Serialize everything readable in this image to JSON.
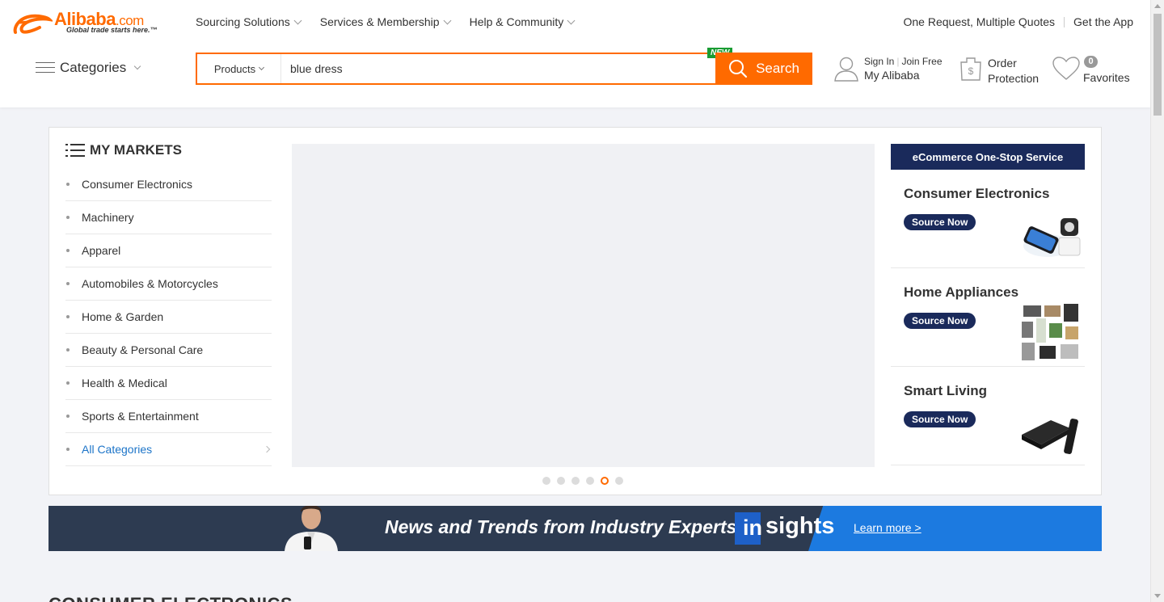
{
  "header": {
    "logo": {
      "brand": "Alibaba",
      "brand_suffix": ".com",
      "tagline": "Global trade starts here.™"
    },
    "nav": [
      {
        "label": "Sourcing Solutions"
      },
      {
        "label": "Services & Membership"
      },
      {
        "label": "Help & Community"
      }
    ],
    "top_right": {
      "quotes": "One Request, Multiple Quotes",
      "app": "Get the App"
    },
    "categories_label": "Categories",
    "search": {
      "type_label": "Products",
      "value": "blue dress",
      "button_label": "Search",
      "new_badge": "NEW"
    },
    "account": {
      "sign_in": "Sign In",
      "join": "Join Free",
      "my_alibaba": "My Alibaba"
    },
    "order": {
      "line1": "Order",
      "line2": "Protection"
    },
    "favorites": {
      "count": "0",
      "label": "Favorites"
    }
  },
  "markets": {
    "title": "MY MARKETS",
    "items": [
      "Consumer Electronics",
      "Machinery",
      "Apparel",
      "Automobiles & Motorcycles",
      "Home & Garden",
      "Beauty & Personal Care",
      "Health & Medical",
      "Sports & Entertainment"
    ],
    "all_label": "All Categories"
  },
  "carousel": {
    "active_index": 4,
    "count": 6
  },
  "ecommerce": {
    "title": "eCommerce One-Stop Service",
    "items": [
      {
        "title": "Consumer Electronics",
        "button": "Source Now"
      },
      {
        "title": "Home Appliances",
        "button": "Source Now"
      },
      {
        "title": "Smart Living",
        "button": "Source Now"
      }
    ]
  },
  "insights": {
    "headline": "News and Trends from Industry Experts",
    "logo_in": "in",
    "logo_rest": "sights",
    "learn_more": "Learn more >"
  },
  "section": {
    "title": "CONSUMER ELECTRONICS"
  },
  "colors": {
    "accent": "#ff6a00",
    "navy": "#1a2a5b",
    "link": "#1c74c8",
    "new_badge": "#1a9c33"
  }
}
